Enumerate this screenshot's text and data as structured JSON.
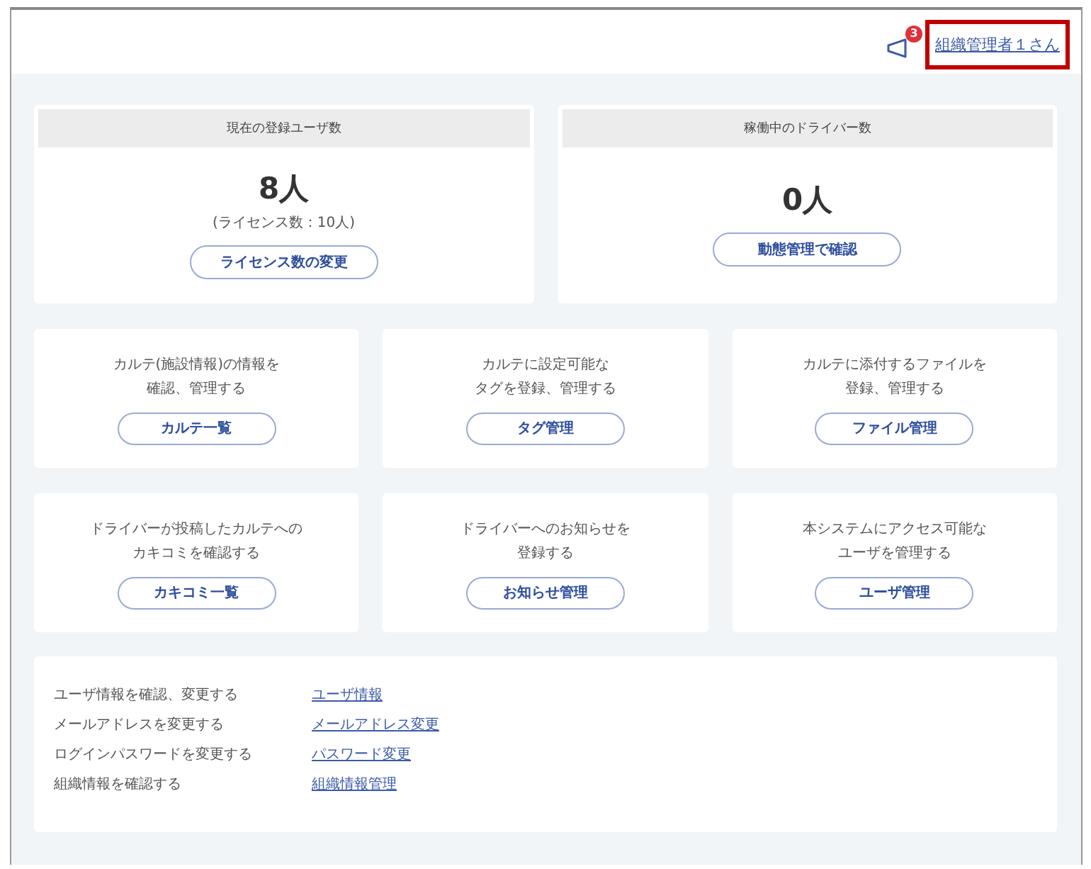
{
  "header": {
    "notification_count": "3",
    "user_link": {
      "label": "組織管理者１さん",
      "highlighted": true
    }
  },
  "stats": [
    {
      "title": "現在の登録ユーザ数",
      "value": "8人",
      "note": "(ライセンス数：10人)",
      "button": "ライセンス数の変更"
    },
    {
      "title": "稼働中のドライバー数",
      "value": "0人",
      "button": "動態管理で確認"
    }
  ],
  "features": [
    {
      "description_lines": [
        "カルテ(施設情報)の情報を",
        "確認、管理する"
      ],
      "button": "カルテ一覧"
    },
    {
      "description_lines": [
        "カルテに設定可能な",
        "タグを登録、管理する"
      ],
      "button": "タグ管理"
    },
    {
      "description_lines": [
        "カルテに添付するファイルを",
        "登録、管理する"
      ],
      "button": "ファイル管理"
    },
    {
      "description_lines": [
        "ドライバーが投稿したカルテへの",
        "カキコミを確認する"
      ],
      "button": "カキコミ一覧"
    },
    {
      "description_lines": [
        "ドライバーへのお知らせを",
        "登録する"
      ],
      "button": "お知らせ管理"
    },
    {
      "description_lines": [
        "本システムにアクセス可能な",
        "ユーザを管理する"
      ],
      "button": "ユーザ管理"
    }
  ],
  "account_links": [
    {
      "description": "ユーザ情報を確認、変更する",
      "link": "ユーザ情報"
    },
    {
      "description": "メールアドレスを変更する",
      "link": "メールアドレス変更"
    },
    {
      "description": "ログインパスワードを変更する",
      "link": "パスワード変更"
    },
    {
      "description": "組織情報を確認する",
      "link": "組織情報管理"
    }
  ]
}
